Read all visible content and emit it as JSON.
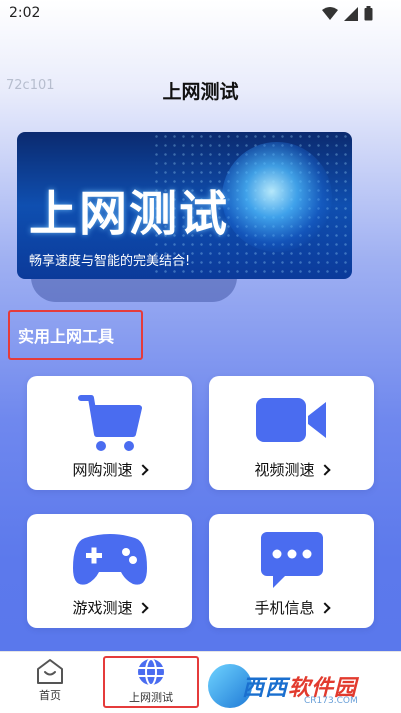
{
  "status": {
    "time": "2:02"
  },
  "watermark": "72c101",
  "header": {
    "title": "上网测试"
  },
  "banner": {
    "title": "上网测试",
    "subtitle": "畅享速度与智能的完美结合!"
  },
  "section": {
    "label": "实用上网工具"
  },
  "tools": [
    {
      "label": "网购测速",
      "icon": "shopping-cart-icon"
    },
    {
      "label": "视频测速",
      "icon": "video-camera-icon"
    },
    {
      "label": "游戏测速",
      "icon": "gamepad-icon"
    },
    {
      "label": "手机信息",
      "icon": "chat-bubble-icon"
    }
  ],
  "tabbar": {
    "items": [
      {
        "label": "首页",
        "icon": "home-icon"
      },
      {
        "label": "上网测试",
        "icon": "globe-icon"
      }
    ]
  },
  "badge": {
    "text_blue": "西西",
    "text_red": "软件园",
    "url": "CR173.COM"
  },
  "colors": {
    "accent": "#4a6cf0",
    "highlight": "#e53b3b"
  }
}
